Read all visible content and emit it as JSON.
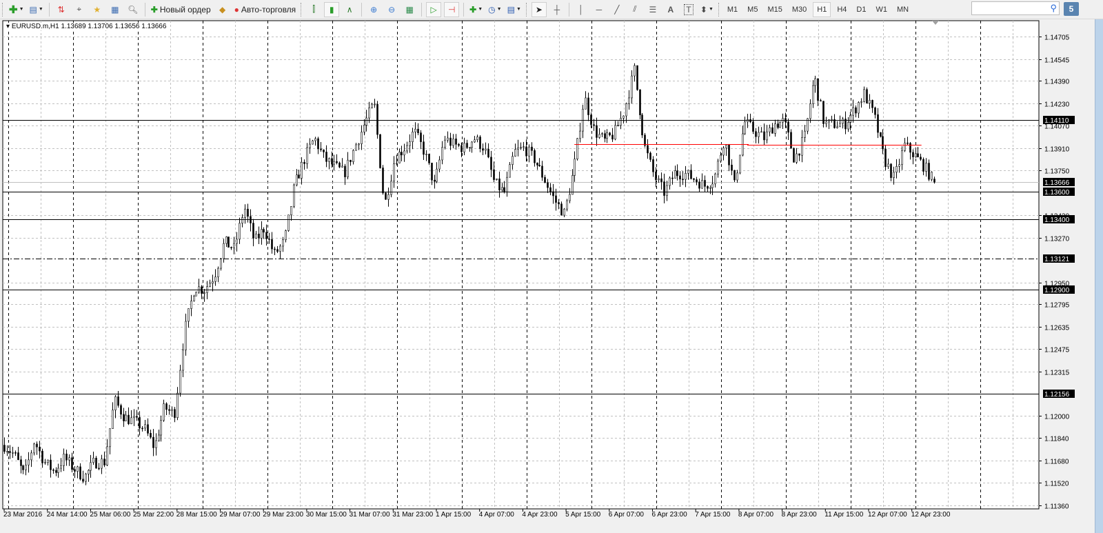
{
  "toolbar": {
    "new_order_label": "Новый ордер",
    "auto_trading_label": "Авто-торговля",
    "timeframes": [
      "M1",
      "M5",
      "M15",
      "M30",
      "H1",
      "H4",
      "D1",
      "W1",
      "MN"
    ],
    "active_timeframe": "H1",
    "search_placeholder": "",
    "notification_count": "5"
  },
  "chart": {
    "symbol_info": "EURUSD.m,H1  1.13689 1.13706 1.13656 1.13666",
    "colors": {
      "background": "#ffffff",
      "candle": "#000000",
      "grid": "#c0c0c0",
      "level_line": "#000000",
      "red_line": "#ff0000",
      "bid_line": "#c0c0c0"
    }
  },
  "chart_data": {
    "type": "candlestick",
    "symbol": "EURUSD.m",
    "timeframe": "H1",
    "last_bar": {
      "open": 1.13689,
      "high": 1.13706,
      "low": 1.13656,
      "close": 1.13666
    },
    "ylim": [
      1.1136,
      1.14785
    ],
    "y_ticks": [
      "1.14705",
      "1.14545",
      "1.14390",
      "1.14230",
      "1.14070",
      "1.13910",
      "1.13750",
      "1.13430",
      "1.13270",
      "1.12950",
      "1.12795",
      "1.12635",
      "1.12475",
      "1.12315",
      "1.12000",
      "1.11840",
      "1.11680",
      "1.11520",
      "1.11360"
    ],
    "x_ticks": [
      "23 Mar 2016",
      "24 Mar 14:00",
      "25 Mar 06:00",
      "25 Mar 22:00",
      "28 Mar 15:00",
      "29 Mar 07:00",
      "29 Mar 23:00",
      "30 Mar 15:00",
      "31 Mar 07:00",
      "31 Mar 23:00",
      "1 Apr 15:00",
      "4 Apr 07:00",
      "4 Apr 23:00",
      "5 Apr 15:00",
      "6 Apr 07:00",
      "6 Apr 23:00",
      "7 Apr 15:00",
      "8 Apr 07:00",
      "8 Apr 23:00",
      "11 Apr 15:00",
      "12 Apr 07:00",
      "12 Apr 23:00"
    ],
    "horizontal_levels": [
      {
        "price": "1.14110",
        "style": "solid"
      },
      {
        "price": "1.13600",
        "style": "solid"
      },
      {
        "price": "1.13400",
        "style": "solid"
      },
      {
        "price": "1.13121",
        "style": "dashdot"
      },
      {
        "price": "1.12900",
        "style": "solid"
      },
      {
        "price": "1.12156",
        "style": "solid"
      }
    ],
    "bid_price": "1.13666",
    "red_segments": [
      {
        "price": 1.1394,
        "from": "5 Apr 15:00",
        "to": "8 Apr 07:00"
      },
      {
        "price": 1.13935,
        "from": "8 Apr 07:00",
        "to": "12 Apr 23:00"
      }
    ],
    "approx_close_path": [
      1.1179,
      1.1172,
      1.1157,
      1.1182,
      1.1167,
      1.116,
      1.117,
      1.1162,
      1.1156,
      1.1167,
      1.1167,
      1.1211,
      1.1199,
      1.1196,
      1.1191,
      1.1177,
      1.1206,
      1.1201,
      1.126,
      1.1292,
      1.129,
      1.13,
      1.1324,
      1.1319,
      1.1349,
      1.1324,
      1.1334,
      1.1315,
      1.1324,
      1.1364,
      1.1383,
      1.1398,
      1.1383,
      1.1378,
      1.1373,
      1.1391,
      1.1408,
      1.1423,
      1.1349,
      1.1383,
      1.1391,
      1.1403,
      1.1388,
      1.1364,
      1.1398,
      1.1393,
      1.1391,
      1.1398,
      1.1391,
      1.1366,
      1.1359,
      1.1388,
      1.1391,
      1.1383,
      1.1369,
      1.1354,
      1.1344,
      1.1378,
      1.1428,
      1.1403,
      1.1396,
      1.1401,
      1.1418,
      1.1447,
      1.1393,
      1.1371,
      1.1359,
      1.1373,
      1.1373,
      1.1369,
      1.1364,
      1.1369,
      1.1398,
      1.1364,
      1.141,
      1.1403,
      1.1398,
      1.1408,
      1.141,
      1.1383,
      1.1398,
      1.1442,
      1.1408,
      1.1408,
      1.1408,
      1.1418,
      1.143,
      1.1413,
      1.1383,
      1.1369,
      1.1393,
      1.1386,
      1.1378,
      1.13666
    ]
  }
}
